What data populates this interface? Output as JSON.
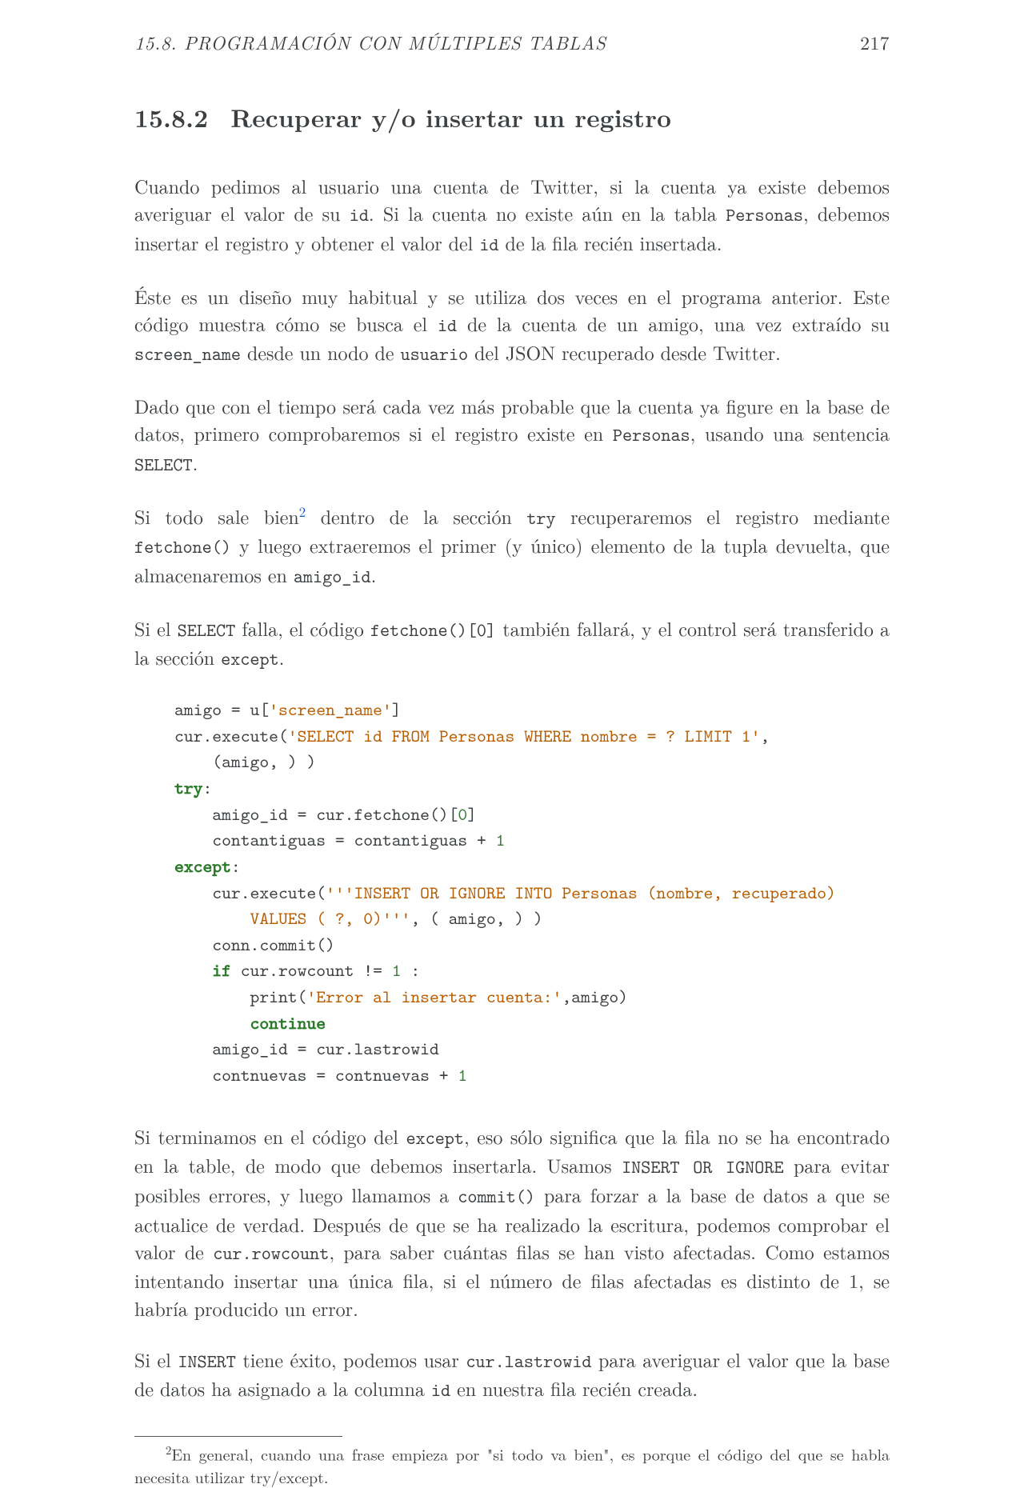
{
  "header": {
    "running_title": "15.8.  PROGRAMACIÓN CON MÚLTIPLES TABLAS",
    "page_number": "217"
  },
  "section": {
    "number": "15.8.2",
    "title": "Recuperar y/o insertar un registro"
  },
  "paragraphs": {
    "p1_a": "Cuando pedimos al usuario una cuenta de Twitter, si la cuenta ya existe debemos averiguar el valor de su ",
    "p1_code1": "id",
    "p1_b": ". Si la cuenta no existe aún en la tabla ",
    "p1_code2": "Personas",
    "p1_c": ", debemos insertar el registro y obtener el valor del ",
    "p1_code3": "id",
    "p1_d": " de la fila recién insertada.",
    "p2_a": "Éste es un diseño muy habitual y se utiliza dos veces en el programa anterior. Este código muestra cómo se busca el ",
    "p2_code1": "id",
    "p2_b": " de la cuenta de un amigo, una vez extraído su ",
    "p2_code2": "screen_name",
    "p2_c": " desde un nodo de ",
    "p2_code3": "usuario",
    "p2_d": " del JSON recuperado desde Twitter.",
    "p3_a": "Dado que con el tiempo será cada vez más probable que la cuenta ya figure en la base de datos, primero comprobaremos si el registro existe en ",
    "p3_code1": "Personas",
    "p3_b": ", usando una sentencia ",
    "p3_code2": "SELECT",
    "p3_c": ".",
    "p4_a": "Si todo sale bien",
    "p4_fn": "2",
    "p4_b": " dentro de la sección ",
    "p4_code1": "try",
    "p4_c": " recuperaremos el registro mediante ",
    "p4_code2": "fetchone()",
    "p4_d": " y luego extraeremos el primer (y único) elemento de la tupla devuelta, que almacenaremos en ",
    "p4_code3": "amigo_id",
    "p4_e": ".",
    "p5_a": "Si el ",
    "p5_code1": "SELECT",
    "p5_b": " falla, el código ",
    "p5_code2": "fetchone()[0]",
    "p5_c": " también fallará, y el control será transferido a la sección ",
    "p5_code3": "except",
    "p5_d": ".",
    "p6_a": "Si terminamos en el código del ",
    "p6_code1": "except",
    "p6_b": ", eso sólo significa que la fila no se ha encontrado en la table, de modo que debemos insertarla. Usamos ",
    "p6_code2": "INSERT OR IGNORE",
    "p6_c": " para evitar posibles errores, y luego llamamos a ",
    "p6_code3": "commit()",
    "p6_d": " para forzar a la base de datos a que se actualice de verdad. Después de que se ha realizado la escritura, podemos comprobar el valor de ",
    "p6_code4": "cur.rowcount",
    "p6_e": ", para saber cuántas filas se han visto afectadas. Como estamos intentando insertar una única fila, si el número de filas afectadas es distinto de 1, se habría producido un error.",
    "p7_a": "Si el ",
    "p7_code1": "INSERT",
    "p7_b": " tiene éxito, podemos usar ",
    "p7_code2": "cur.lastrowid",
    "p7_c": " para averiguar el valor que la base de datos ha asignado a la columna ",
    "p7_code3": "id",
    "p7_d": " en nuestra fila recién creada."
  },
  "code": {
    "l1a": "amigo = u[",
    "l1s": "'screen_name'",
    "l1b": "]",
    "l2a": "cur.execute(",
    "l2s": "'SELECT id FROM Personas WHERE nombre = ? LIMIT 1'",
    "l2b": ",",
    "l3a": "    (amigo, ) )",
    "l4k": "try",
    "l4b": ":",
    "l5a": "    amigo_id = cur.fetchone()[",
    "l5n": "0",
    "l5b": "]",
    "l6a": "    contantiguas = contantiguas + ",
    "l6n": "1",
    "l7k": "except",
    "l7b": ":",
    "l8a": "    cur.execute(",
    "l8s": "'''INSERT OR IGNORE INTO Personas (nombre, recuperado)",
    "l9s": "        VALUES ( ?, 0)'''",
    "l9b": ", ( amigo, ) )",
    "l10a": "    conn.commit()",
    "l11a": "    ",
    "l11k": "if",
    "l11b": " cur.rowcount != ",
    "l11n": "1",
    "l11c": " :",
    "l12a": "        print(",
    "l12s": "'Error al insertar cuenta:'",
    "l12b": ",amigo)",
    "l13a": "        ",
    "l13k": "continue",
    "l14a": "    amigo_id = cur.lastrowid",
    "l15a": "    contnuevas = contnuevas + ",
    "l15n": "1"
  },
  "footnote": {
    "marker": "2",
    "text": "En general, cuando una frase empieza por \"si todo va bien\", es porque el código del que se habla necesita utilizar try/except."
  }
}
